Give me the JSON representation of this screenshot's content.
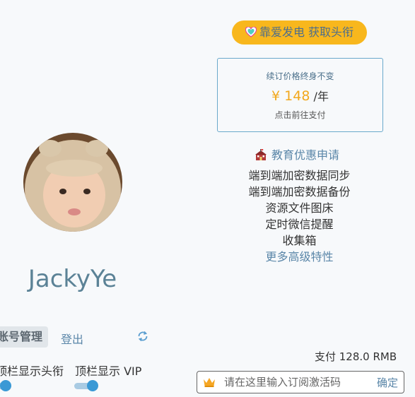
{
  "profile": {
    "username": "JackyYe"
  },
  "account": {
    "manage_label": "账号管理",
    "logout_label": "登出"
  },
  "toggles": {
    "show_title_label": "顶栏显示头衔",
    "show_vip_label": "顶栏显示 VIP"
  },
  "sponsor": {
    "button_label": "靠爱发电 获取头衔"
  },
  "price": {
    "note": "续订价格终身不变",
    "amount": "¥ 148",
    "unit": "/年",
    "go_pay": "点击前往支付"
  },
  "education": {
    "label": "教育优惠申请"
  },
  "features": {
    "items": [
      "端到端加密数据同步",
      "端到端加密数据备份",
      "资源文件图床",
      "定时微信提醒",
      "收集箱"
    ],
    "more_label": "更多高级特性"
  },
  "payment": {
    "paid_text": "支付  128.0 RMB",
    "code_placeholder": "请在这里输入订阅激活码",
    "confirm_label": "确定"
  },
  "colors": {
    "accent": "#5a86a8",
    "gold": "#f8b71d",
    "toggle_blue": "#3a99d5"
  }
}
